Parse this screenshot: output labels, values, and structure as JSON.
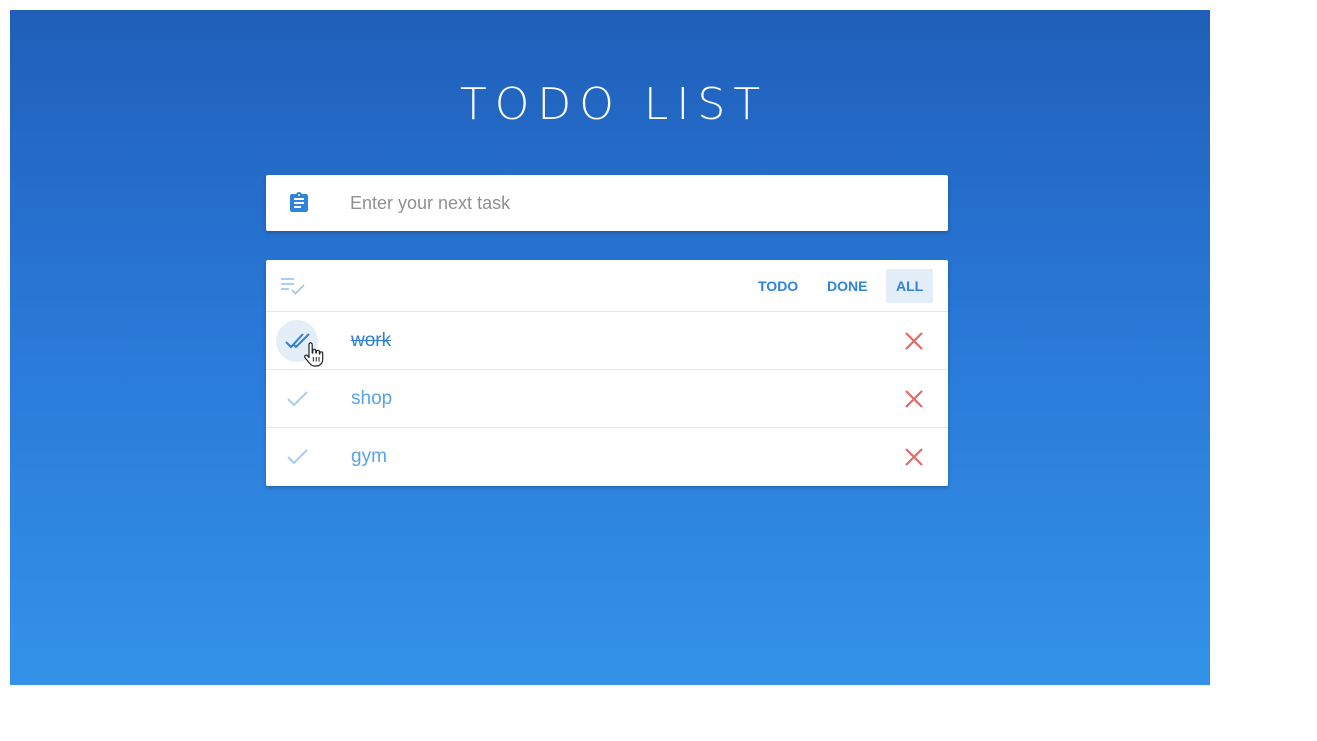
{
  "app": {
    "title": "TODO LIST"
  },
  "input": {
    "placeholder": "Enter your next task",
    "value": "",
    "icon": "clipboard-icon"
  },
  "toolbar": {
    "icon": "playlist-check-icon",
    "filters": [
      {
        "label": "TODO",
        "active": false
      },
      {
        "label": "DONE",
        "active": false
      },
      {
        "label": "ALL",
        "active": true
      }
    ]
  },
  "tasks": [
    {
      "label": "work",
      "done": true
    },
    {
      "label": "shop",
      "done": false
    },
    {
      "label": "gym",
      "done": false
    }
  ],
  "colors": {
    "accent": "#2f83dc",
    "delete": "#e26a6a",
    "background_top": "#1f5fb9",
    "background_bottom": "#3392e8"
  }
}
